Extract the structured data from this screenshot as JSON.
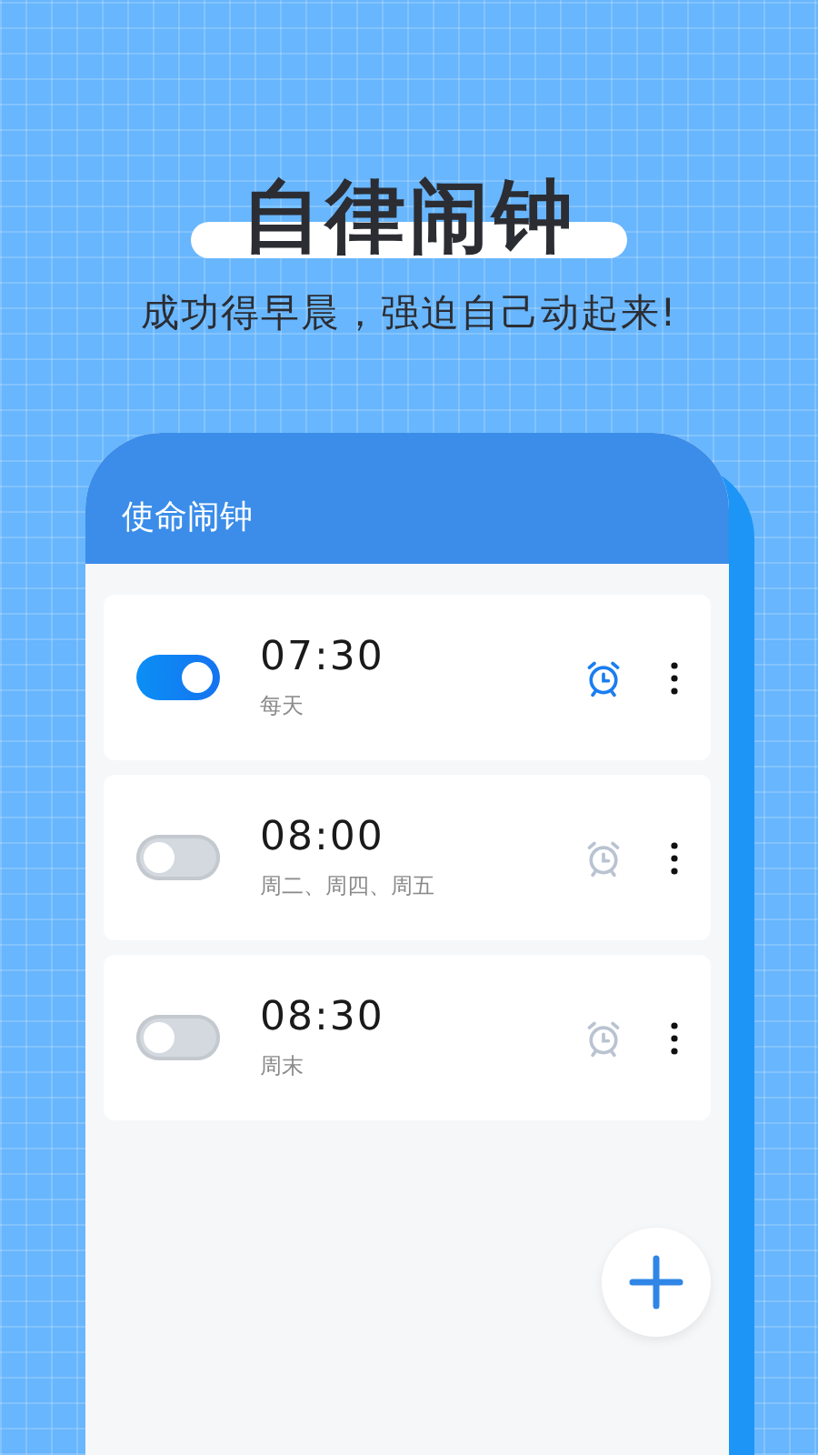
{
  "headline": "自律闹钟",
  "tagline": "成功得早晨，强迫自己动起来!",
  "app": {
    "title": "使命闹钟",
    "alarms": [
      {
        "time": "07:30",
        "repeat": "每天",
        "on": true
      },
      {
        "time": "08:00",
        "repeat": "周二、周四、周五",
        "on": false
      },
      {
        "time": "08:30",
        "repeat": "周末",
        "on": false
      }
    ]
  }
}
